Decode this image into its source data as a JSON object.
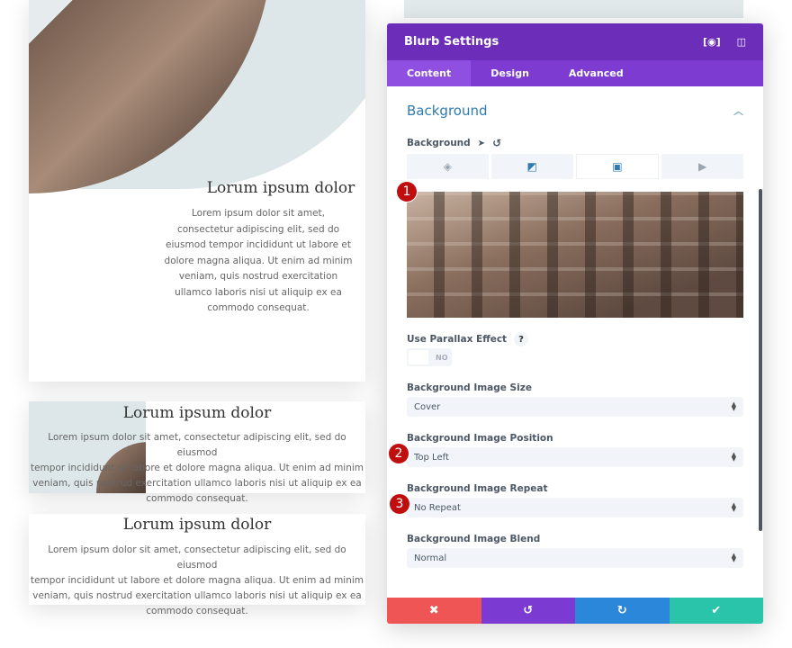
{
  "cards": [
    {
      "title": "Lorum ipsum dolor",
      "lines": [
        "Lorem ipsum dolor sit amet,",
        "consectetur adipiscing elit, sed do",
        "eiusmod tempor incididunt ut labore et",
        "dolore magna aliqua. Ut enim ad minim",
        "veniam, quis nostrud exercitation",
        "ullamco laboris nisi ut aliquip ex ea",
        "commodo consequat."
      ]
    },
    {
      "title": "Lorum ipsum dolor",
      "lines": [
        "Lorem ipsum dolor sit amet, consectetur adipiscing elit, sed do eiusmod",
        "tempor incididunt ut labore et dolore magna aliqua. Ut enim ad minim",
        "veniam, quis nostrud exercitation ullamco laboris nisi ut aliquip ex ea",
        "commodo consequat."
      ]
    },
    {
      "title": "Lorum ipsum dolor",
      "lines": [
        "Lorem ipsum dolor sit amet, consectetur adipiscing elit, sed do eiusmod",
        "tempor incididunt ut labore et dolore magna aliqua. Ut enim ad minim",
        "veniam, quis nostrud exercitation ullamco laboris nisi ut aliquip ex ea",
        "commodo consequat."
      ]
    }
  ],
  "panel": {
    "title": "Blurb Settings",
    "tabs": [
      "Content",
      "Design",
      "Advanced"
    ],
    "section": "Background",
    "background_label": "Background",
    "parallax": {
      "label": "Use Parallax Effect",
      "help": "?",
      "value": "NO"
    },
    "fields": [
      {
        "label": "Background Image Size",
        "value": "Cover"
      },
      {
        "label": "Background Image Position",
        "value": "Top Left"
      },
      {
        "label": "Background Image Repeat",
        "value": "No Repeat"
      },
      {
        "label": "Background Image Blend",
        "value": "Normal"
      }
    ],
    "badges": [
      "1",
      "2",
      "3"
    ],
    "footer_colors": {
      "cancel": "#ef5555",
      "undo": "#7b3ad1",
      "redo": "#2b87da",
      "save": "#29c4a9"
    }
  }
}
